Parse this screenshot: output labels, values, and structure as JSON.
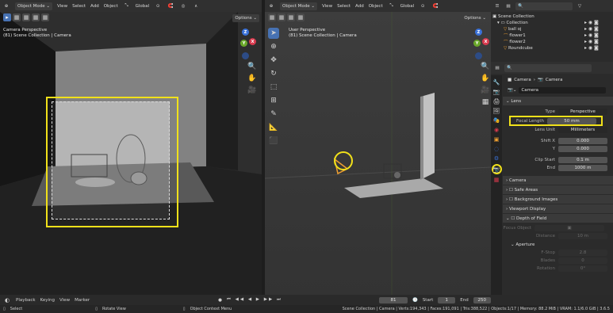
{
  "left_viewport": {
    "mode": "Object Mode",
    "menus": [
      "View",
      "Select",
      "Add",
      "Object"
    ],
    "transform": "Global",
    "options": "Options",
    "title": "Camera Perspective",
    "subtitle": "(81) Scene Collection | Camera"
  },
  "right_viewport": {
    "mode": "Object Mode",
    "menus": [
      "View",
      "Select",
      "Add",
      "Object"
    ],
    "transform": "Global",
    "options": "Options",
    "title": "User Perspective",
    "subtitle": "(81) Scene Collection | Camera"
  },
  "gizmo": {
    "x": "X",
    "y": "Y",
    "z": "Z"
  },
  "outliner": {
    "root": "Scene Collection",
    "collection": "Collection",
    "items": [
      "ball oj",
      "flower1",
      "flower2",
      "Roundcube"
    ]
  },
  "properties": {
    "breadcrumb_a": "Camera",
    "breadcrumb_b": "Camera",
    "data_name": "Camera",
    "lens": {
      "header": "Lens",
      "type_label": "Type",
      "type_value": "Perspective",
      "focal_label": "Focal Length",
      "focal_value": "50 mm",
      "unit_label": "Lens Unit",
      "unit_value": "Millimeters",
      "shiftx_label": "Shift X",
      "shiftx_value": "0.000",
      "y_label": "Y",
      "y_value": "0.000",
      "clipstart_label": "Clip Start",
      "clipstart_value": "0.1 m",
      "end_label": "End",
      "end_value": "1000 m"
    },
    "panels": [
      "Camera",
      "Safe Areas",
      "Background Images",
      "Viewport Display"
    ],
    "dof": {
      "header": "Depth of Field",
      "focus_label": "Focus Object",
      "distance_label": "Distance",
      "distance_value": "10 m",
      "aperture": "Aperture",
      "fstop_label": "F-Stop",
      "fstop_value": "2.8",
      "blades_label": "Blades",
      "blades_value": "0",
      "rotation_label": "Rotation",
      "rotation_value": "0°"
    }
  },
  "timeline": {
    "menus": [
      "Playback",
      "Keying",
      "View",
      "Marker"
    ],
    "current_frame": "81",
    "start_label": "Start",
    "start_value": "1",
    "end_label": "End",
    "end_value": "250"
  },
  "statusbar": {
    "select": "Select",
    "rotate": "Rotate View",
    "context": "Object Context Menu",
    "stats": "Scene Collection | Camera | Verts:194,343 | Faces:191,091 | Tris:388,522 | Objects:1/17 | Memory: 88.2 MiB | VRAM: 1.1/6.0 GiB | 3.6.5"
  },
  "colors": {
    "highlight": "#f1e11a",
    "accent": "#4772b3",
    "x_axis": "#d83a4e",
    "y_axis": "#6aa82a",
    "z_axis": "#3a71d8"
  }
}
